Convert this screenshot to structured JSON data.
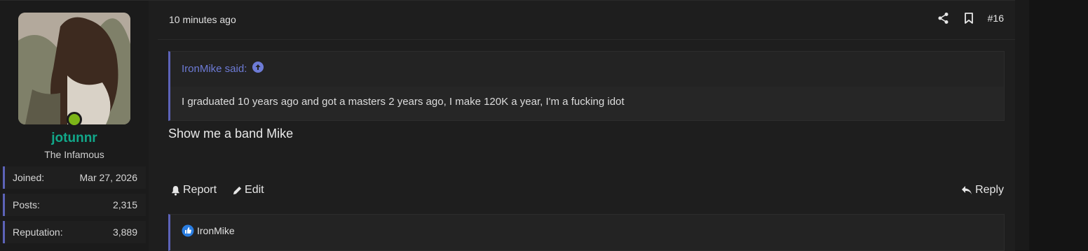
{
  "user": {
    "username": "jotunnr",
    "title": "The Infamous",
    "stats": [
      {
        "label": "Joined:",
        "value": "Mar 27, 2026"
      },
      {
        "label": "Posts:",
        "value": "2,315"
      },
      {
        "label": "Reputation:",
        "value": "3,889"
      }
    ]
  },
  "post": {
    "time": "10 minutes ago",
    "number": "#16",
    "quote": {
      "author": "IronMike said:",
      "text": "I graduated 10 years ago and got a masters 2 years ago, I make 120K a year, I'm a fucking idot"
    },
    "message": "Show me a band Mike",
    "actions": {
      "report": "Report",
      "edit": "Edit",
      "reply": "Reply"
    },
    "likes": {
      "user": "IronMike"
    }
  },
  "colors": {
    "accent": "#5c63b8",
    "username": "#11a88a",
    "online": "#7cb518",
    "quoteLink": "#6d7bd6"
  }
}
